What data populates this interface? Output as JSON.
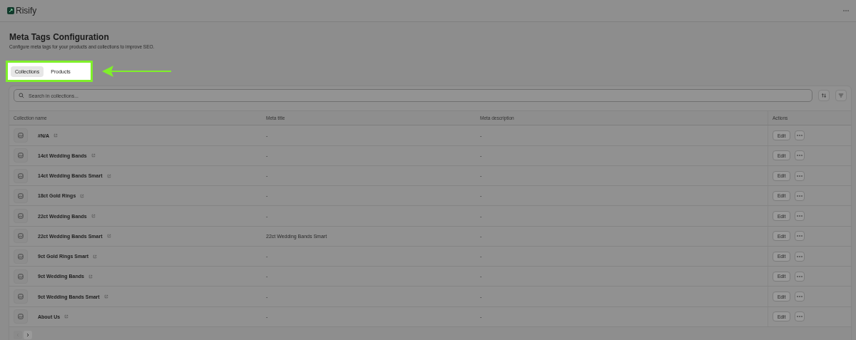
{
  "app": {
    "name": "Risify"
  },
  "page": {
    "title": "Meta Tags Configuration",
    "subtitle": "Configure meta tags for your products and collections to improve SEO."
  },
  "tabs": [
    {
      "label": "Collections",
      "selected": true
    },
    {
      "label": "Products",
      "selected": false
    }
  ],
  "search": {
    "placeholder": "Search in collections..."
  },
  "table": {
    "columns": [
      "Collection name",
      "Meta title",
      "Meta description",
      "Actions"
    ],
    "rows": [
      {
        "name": "#N/A",
        "meta_title": "-",
        "meta_description": "-",
        "edit_label": "Edit"
      },
      {
        "name": "14ct Wedding Bands",
        "meta_title": "-",
        "meta_description": "-",
        "edit_label": "Edit"
      },
      {
        "name": "14ct Wedding Bands Smart",
        "meta_title": "-",
        "meta_description": "-",
        "edit_label": "Edit"
      },
      {
        "name": "18ct Gold Rings",
        "meta_title": "-",
        "meta_description": "-",
        "edit_label": "Edit"
      },
      {
        "name": "22ct Wedding Bands",
        "meta_title": "-",
        "meta_description": "-",
        "edit_label": "Edit"
      },
      {
        "name": "22ct Wedding Bands Smart",
        "meta_title": "22ct Wedding Bands Smart",
        "meta_description": "-",
        "edit_label": "Edit"
      },
      {
        "name": "9ct Gold Rings Smart",
        "meta_title": "-",
        "meta_description": "-",
        "edit_label": "Edit"
      },
      {
        "name": "9ct Wedding Bands",
        "meta_title": "-",
        "meta_description": "-",
        "edit_label": "Edit"
      },
      {
        "name": "9ct Wedding Bands Smart",
        "meta_title": "-",
        "meta_description": "-",
        "edit_label": "Edit"
      },
      {
        "name": "About Us",
        "meta_title": "-",
        "meta_description": "-",
        "edit_label": "Edit"
      }
    ]
  },
  "pagination": {
    "previous_disabled": true,
    "next_disabled": false
  }
}
